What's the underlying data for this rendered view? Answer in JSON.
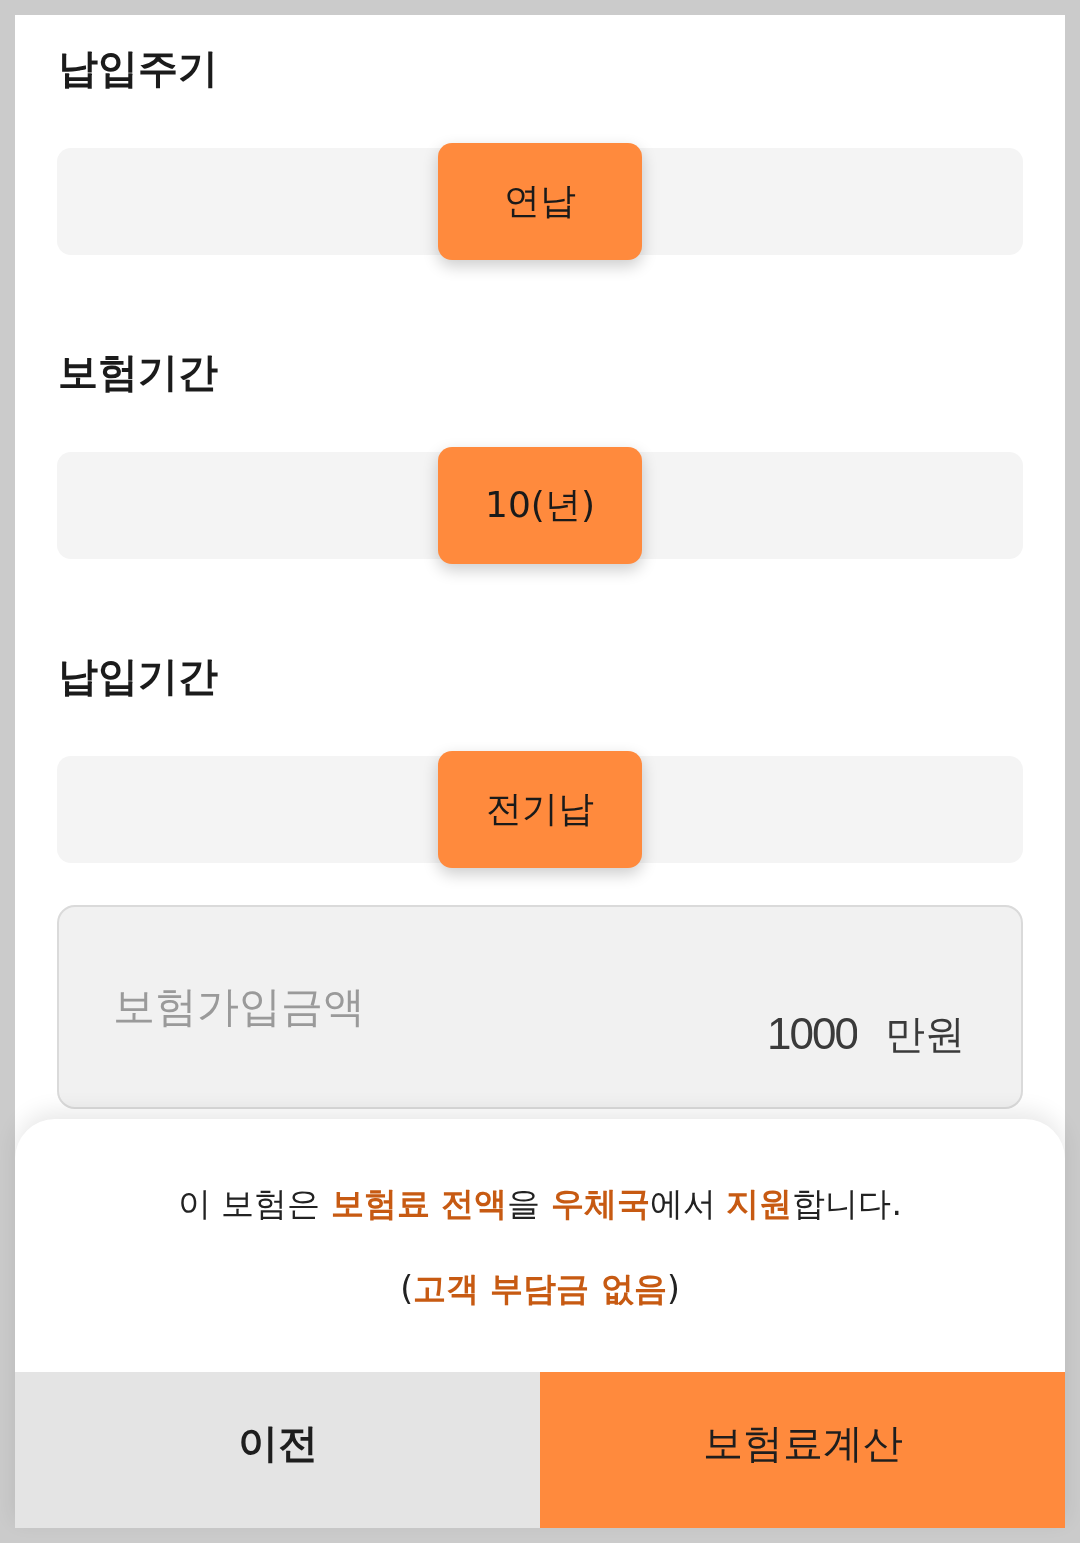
{
  "sections": [
    {
      "label": "납입주기",
      "options": [
        {
          "label": "연납",
          "selected": true
        }
      ]
    },
    {
      "label": "보험기간",
      "options": [
        {
          "label": "10(년)",
          "selected": true
        }
      ]
    },
    {
      "label": "납입기간",
      "options": [
        {
          "label": "전기납",
          "selected": true
        }
      ]
    }
  ],
  "amount_field": {
    "label": "보험가입금액",
    "value": "1000",
    "unit": "만원"
  },
  "notice": {
    "lines": [
      "이 보험은 **보험료 전액**을 **우체국**에서 **지원**합니다.",
      "(**고객 부담금 없음**)"
    ]
  },
  "buttons": [
    {
      "label": "이전",
      "kind": "secondary"
    },
    {
      "label": "보험료계산",
      "kind": "primary"
    }
  ]
}
